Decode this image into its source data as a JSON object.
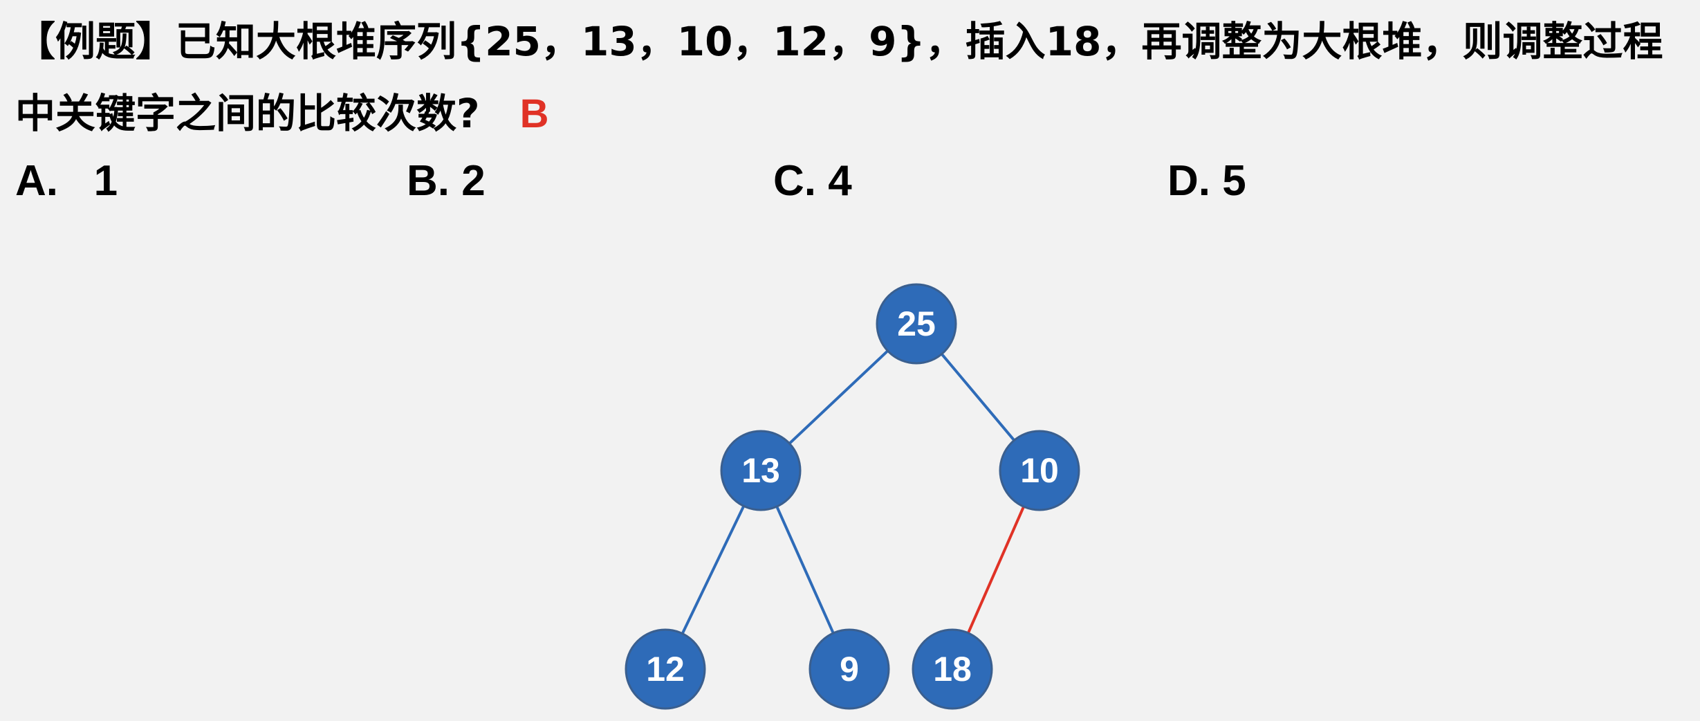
{
  "question": {
    "text": "【例题】已知大根堆序列{25，13，10，12，9}，插入18，再调整为大根堆，则调整过程中关键字之间的比较次数?",
    "answer": "B"
  },
  "options": {
    "a": "A.   1",
    "b": "B. 2",
    "c": "C. 4",
    "d": "D. 5"
  },
  "heap": {
    "nodes": [
      {
        "id": "n25",
        "value": "25"
      },
      {
        "id": "n13",
        "value": "13"
      },
      {
        "id": "n10",
        "value": "10"
      },
      {
        "id": "n12",
        "value": "12"
      },
      {
        "id": "n9",
        "value": "9"
      },
      {
        "id": "n18",
        "value": "18"
      }
    ],
    "edges": [
      {
        "from": "n25",
        "to": "n13",
        "highlighted": false
      },
      {
        "from": "n25",
        "to": "n10",
        "highlighted": false
      },
      {
        "from": "n13",
        "to": "n12",
        "highlighted": false
      },
      {
        "from": "n13",
        "to": "n9",
        "highlighted": false
      },
      {
        "from": "n10",
        "to": "n18",
        "highlighted": true
      }
    ],
    "colors": {
      "node_fill": "#2e6bb8",
      "node_stroke": "#3a5f8f",
      "edge": "#2e6bb8",
      "highlight_edge": "#e03226"
    }
  }
}
